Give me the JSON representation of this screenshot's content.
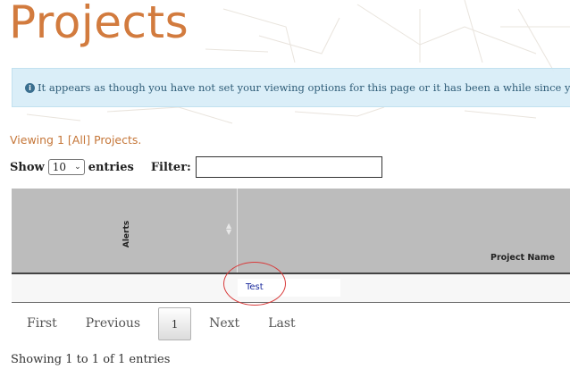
{
  "page": {
    "title": "Projects"
  },
  "alert": {
    "icon": "info-circle-icon",
    "text": "It appears as though you have not set your viewing options for this page or it has been a while since yo"
  },
  "viewing_text": "Viewing 1 [All] Projects.",
  "controls": {
    "show_label": "Show",
    "page_size_value": "10",
    "entries_label": "entries",
    "filter_label": "Filter:",
    "filter_value": ""
  },
  "table": {
    "columns": [
      {
        "label": "Alerts",
        "sort_icon": "sort-both-icon"
      },
      {
        "label": "Project Name"
      }
    ],
    "rows": [
      {
        "alerts": "",
        "project_name": "Test"
      }
    ]
  },
  "pagination": {
    "first": "First",
    "previous": "Previous",
    "current": "1",
    "next": "Next",
    "last": "Last"
  },
  "info_footer": "Showing 1 to 1 of 1 entries",
  "colors": {
    "title": "#d27b3e",
    "viewing_text": "#c57638",
    "alert_bg": "#d7edf8",
    "table_header_bg": "#bcbcbc",
    "link": "#1a2a9c",
    "annotation_circle": "#d83a3a"
  }
}
